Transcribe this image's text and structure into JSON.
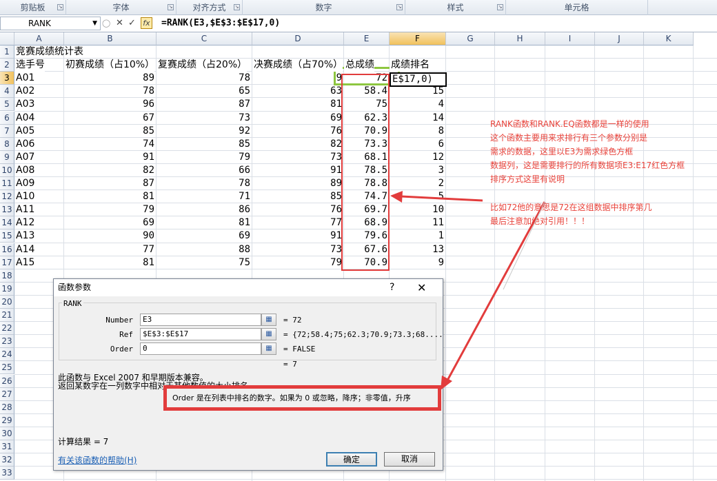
{
  "ribbon": {
    "groups": [
      "剪贴板",
      "字体",
      "对齐方式",
      "数字",
      "样式",
      "单元格"
    ]
  },
  "formula_bar": {
    "name_box": "RANK",
    "cancel_glyph": "✕",
    "enter_glyph": "✓",
    "fx_glyph": "fx",
    "formula": "=RANK(E3,$E$3:$E$17,0)"
  },
  "columns": [
    "A",
    "B",
    "C",
    "D",
    "E",
    "F",
    "G",
    "H",
    "I",
    "J",
    "K"
  ],
  "rows": [
    "1",
    "2",
    "3",
    "4",
    "5",
    "6",
    "7",
    "8",
    "9",
    "10",
    "11",
    "12",
    "13",
    "14",
    "15",
    "16",
    "17",
    "18",
    "19",
    "20",
    "21",
    "22",
    "23",
    "24",
    "25",
    "26",
    "27",
    "28",
    "29",
    "30",
    "31",
    "32",
    "33"
  ],
  "sheet": {
    "title": "竞赛成绩统计表",
    "headers": [
      "选手号",
      "初赛成绩（占10%）",
      "复赛成绩（占20%）",
      "决赛成绩（占70%）",
      "总成绩",
      "成绩排名"
    ],
    "data": [
      [
        "A01",
        "89",
        "78",
        "",
        "72",
        ""
      ],
      [
        "A02",
        "78",
        "65",
        "63",
        "58.4",
        "15"
      ],
      [
        "A03",
        "96",
        "87",
        "81",
        "75",
        "4"
      ],
      [
        "A04",
        "67",
        "73",
        "69",
        "62.3",
        "14"
      ],
      [
        "A05",
        "85",
        "92",
        "76",
        "70.9",
        "8"
      ],
      [
        "A06",
        "74",
        "85",
        "82",
        "73.3",
        "6"
      ],
      [
        "A07",
        "91",
        "79",
        "73",
        "68.1",
        "12"
      ],
      [
        "A08",
        "82",
        "66",
        "91",
        "78.5",
        "3"
      ],
      [
        "A09",
        "87",
        "78",
        "89",
        "78.8",
        "2"
      ],
      [
        "A10",
        "81",
        "71",
        "85",
        "74.7",
        "5"
      ],
      [
        "A11",
        "79",
        "86",
        "76",
        "69.7",
        "10"
      ],
      [
        "A12",
        "69",
        "81",
        "77",
        "68.9",
        "11"
      ],
      [
        "A13",
        "90",
        "69",
        "91",
        "79.6",
        "1"
      ],
      [
        "A14",
        "77",
        "88",
        "73",
        "67.6",
        "13"
      ],
      [
        "A15",
        "81",
        "75",
        "79",
        "70.9",
        "9"
      ]
    ],
    "d3_partial": "9",
    "active_cell_text": "E$17,0)"
  },
  "annotations": {
    "top": [
      "RANK函数和RANK.EQ函数都是一样的使用",
      "这个函数主要用来求排行有三个参数分别是",
      "需求的数据，这里以E3为需求绿色方框",
      "数据列，这是需要排行的所有数据项E3:E17红色方框",
      "排序方式这里有说明"
    ],
    "bottom": [
      "比如72他的意思是72在这组数据中排序第几",
      "最后注意加绝对引用！！！"
    ]
  },
  "dialog": {
    "title": "函数参数",
    "function_name": "RANK",
    "args": [
      {
        "label": "Number",
        "value": "E3",
        "result": "=  72"
      },
      {
        "label": "Ref",
        "value": "$E$3:$E$17",
        "result": "=  {72;58.4;75;62.3;70.9;73.3;68...."
      },
      {
        "label": "Order",
        "value": "0",
        "result": "=  FALSE"
      }
    ],
    "overall_result": "=  7",
    "compat_note": "此函数与 Excel 2007 和早期版本兼容。",
    "description": "返回某数字在一列数字中相对于其他数值的大小排名",
    "order_help": "Order  是在列表中排名的数字。如果为 0 或忽略，降序；非零值，升序",
    "calc_result": "计算结果 =  7",
    "help_link": "有关该函数的帮助(H)",
    "ok": "确定",
    "cancel": "取消",
    "help_glyph": "?",
    "close_glyph": "✕",
    "picker_glyph": "▦"
  },
  "colors": {
    "annotation_red": "#e8433b",
    "green_box": "#8dc63f",
    "selection_orange": "#f1c15c"
  }
}
